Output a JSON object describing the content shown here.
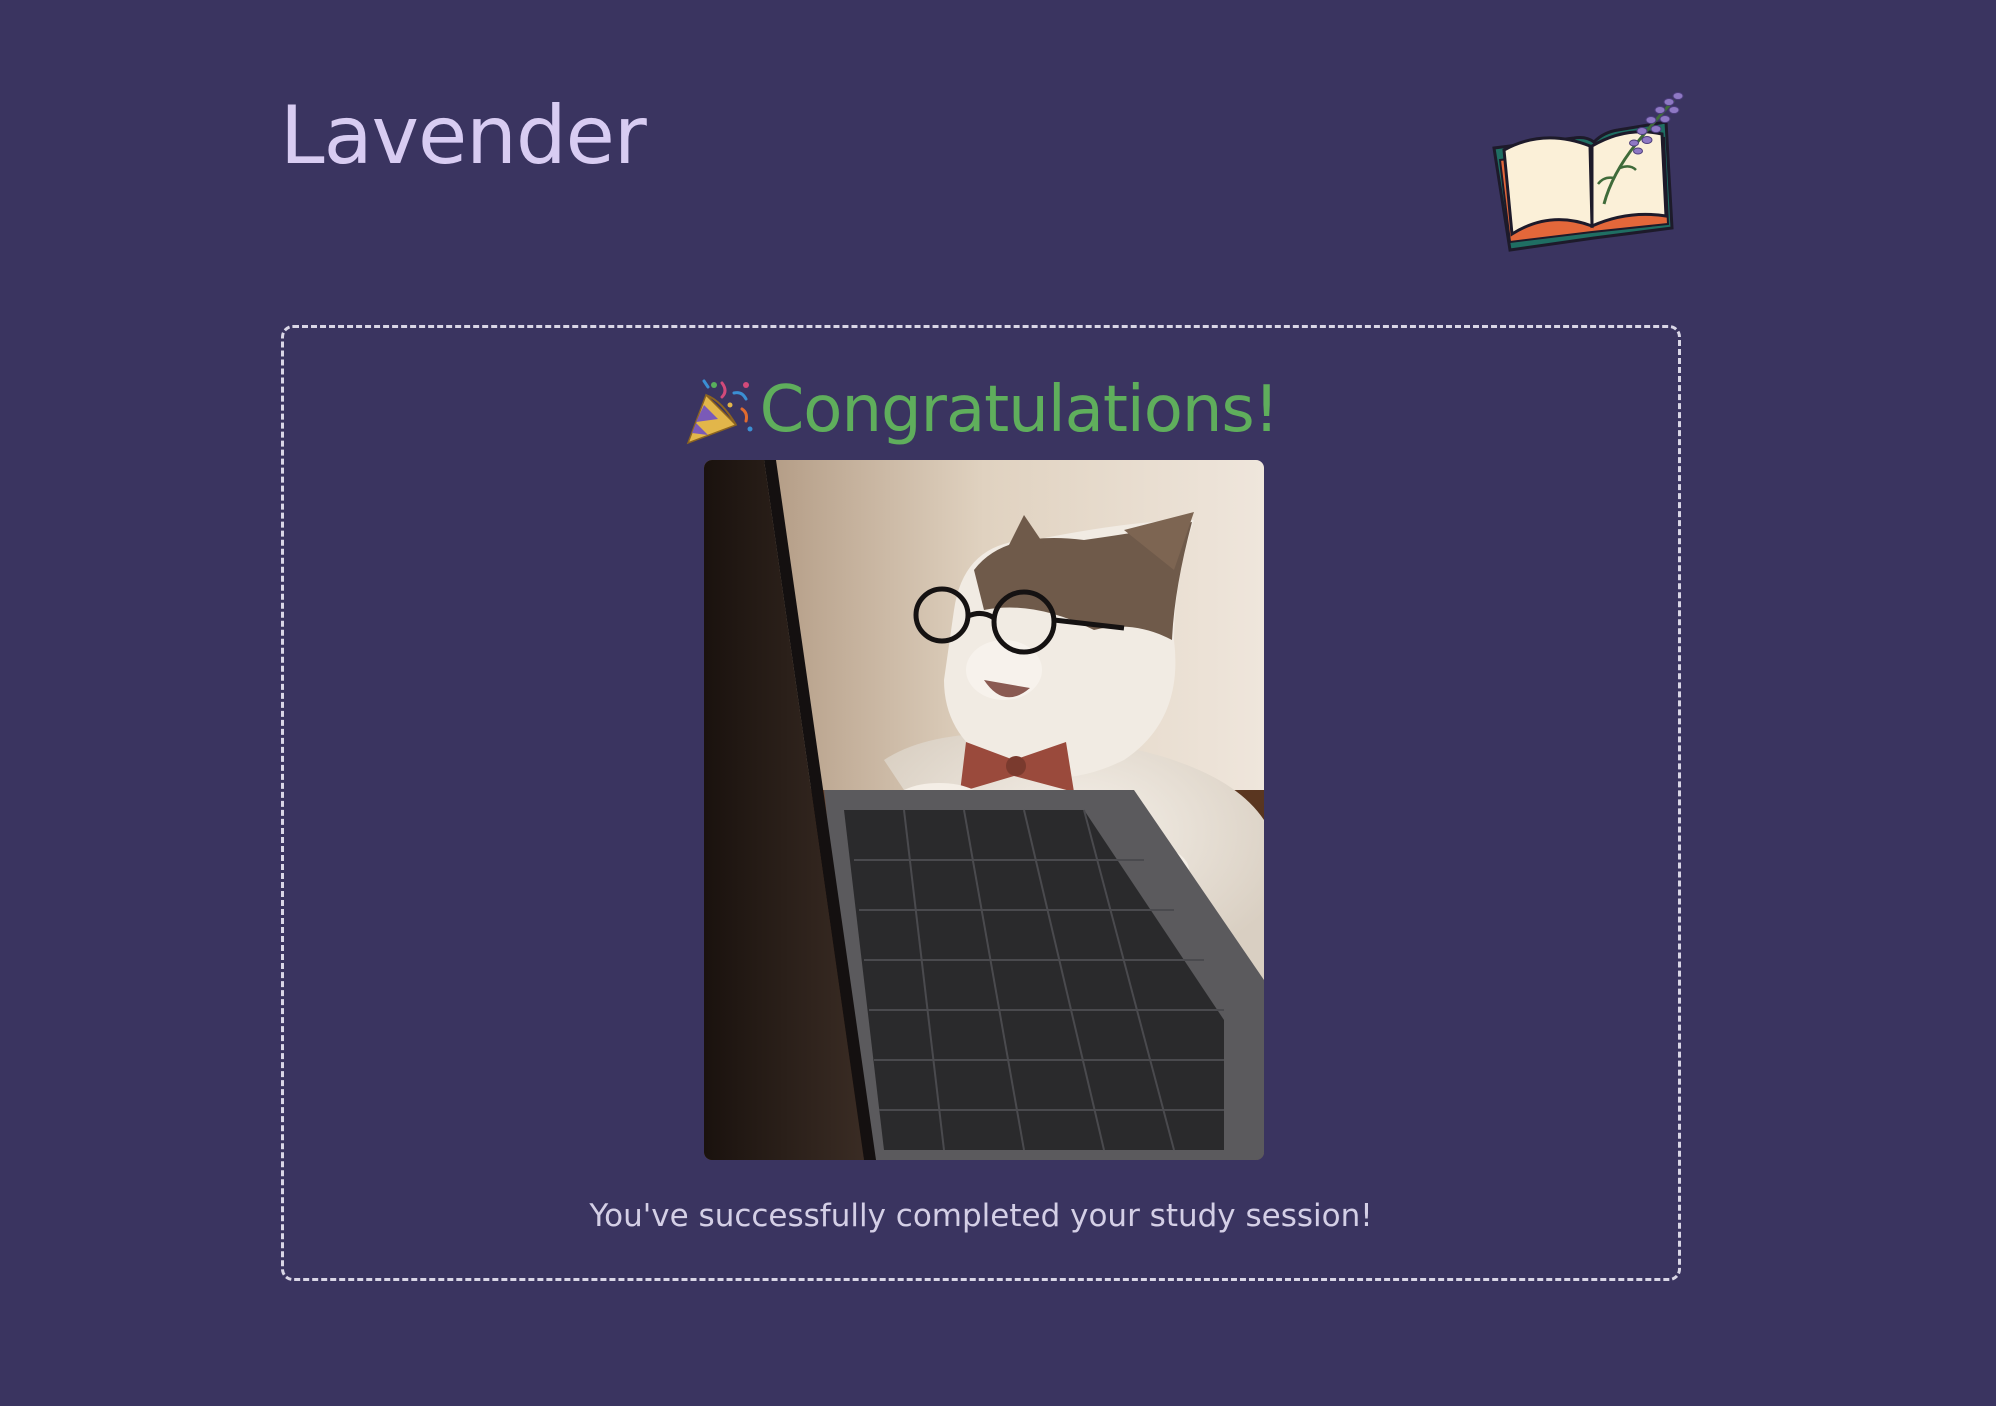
{
  "app": {
    "title": "Lavender",
    "logo": "open-book-with-lavender-sprig"
  },
  "completion_card": {
    "heading": "Congratulations!",
    "heading_icon": "party-popper-icon",
    "image": "cat-wearing-glasses-at-laptop",
    "message": "You've successfully completed your study session!"
  },
  "colors": {
    "background": "#3a3460",
    "title": "#d8ccf2",
    "heading": "#5fae5c",
    "message": "#d4cfe6",
    "card_border": "#d9d6e6"
  }
}
